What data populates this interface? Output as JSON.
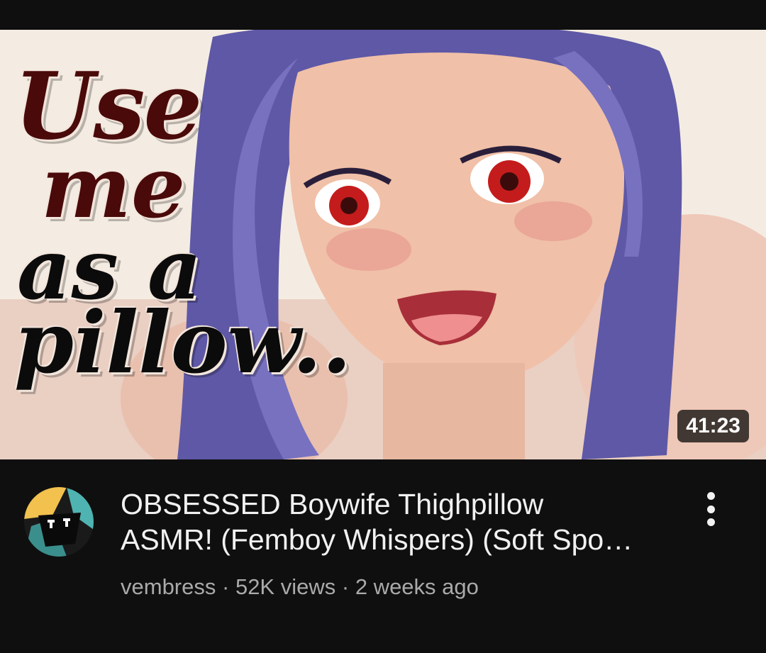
{
  "video": {
    "thumbnail_text": [
      "Use",
      "me",
      "as a",
      "pillow.."
    ],
    "duration": "41:23",
    "title_line1": "OBSESSED Boywife Thighpillow",
    "title_line2": "ASMR! (Femboy Whispers) (Soft Spo…",
    "channel": "vembress",
    "separator": "·",
    "views": "52K views",
    "age": "2 weeks ago"
  },
  "icons": {
    "more": "kebab-menu-icon",
    "avatar": "channel-avatar"
  },
  "colors": {
    "background": "#0f0f0f",
    "title": "#f1f1f1",
    "meta": "#aaaaaa",
    "thumb_text_dark": "#4a0a0a"
  }
}
